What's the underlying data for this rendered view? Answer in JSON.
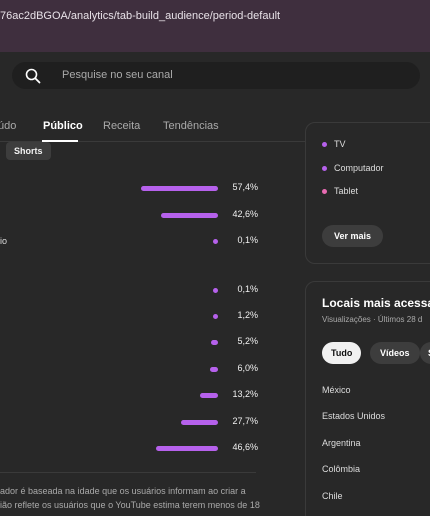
{
  "browser": {
    "url": "76ac2dBGOA/analytics/tab-build_audience/period-default"
  },
  "search": {
    "placeholder": "Pesquise no seu canal"
  },
  "tabs": [
    {
      "label": "údo"
    },
    {
      "label": "Público",
      "active": true
    },
    {
      "label": "Receita"
    },
    {
      "label": "Tendências"
    }
  ],
  "left_panel": {
    "shorts_chip": "Shorts",
    "rows_top": [
      {
        "label": "",
        "value": "57,4%",
        "pct": 57.4
      },
      {
        "label": "",
        "value": "42,6%",
        "pct": 42.6
      },
      {
        "label": "io",
        "value": "0,1%",
        "pct": 0.1
      }
    ],
    "rows_age": [
      {
        "value": "0,1%",
        "pct": 0.1
      },
      {
        "value": "1,2%",
        "pct": 1.2
      },
      {
        "value": "5,2%",
        "pct": 5.2
      },
      {
        "value": "6,0%",
        "pct": 6.0
      },
      {
        "value": "13,2%",
        "pct": 13.2
      },
      {
        "value": "27,7%",
        "pct": 27.7
      },
      {
        "value": "46,6%",
        "pct": 46.6
      }
    ],
    "note_line1": "ador é baseada na idade que os usuários informam ao criar a",
    "note_line2": "ião reflete os usuários que o YouTube estima terem menos de 18"
  },
  "devices_card": {
    "items": [
      {
        "label": "TV",
        "color": "#b661ec"
      },
      {
        "label": "Computador",
        "color": "#b661ec"
      },
      {
        "label": "Tablet",
        "color": "#e86bb2"
      }
    ],
    "see_more": "Ver mais"
  },
  "locations_card": {
    "title": "Locais mais acessad",
    "subtitle": "Visualizações · Últimos 28 d",
    "filters": [
      "Tudo",
      "Vídeos",
      "S"
    ],
    "countries": [
      "México",
      "Estados Unidos",
      "Argentina",
      "Colômbia",
      "Chile"
    ]
  },
  "colors": {
    "accent_bar": "#b661ec",
    "tablet_dot": "#e86bb2"
  }
}
